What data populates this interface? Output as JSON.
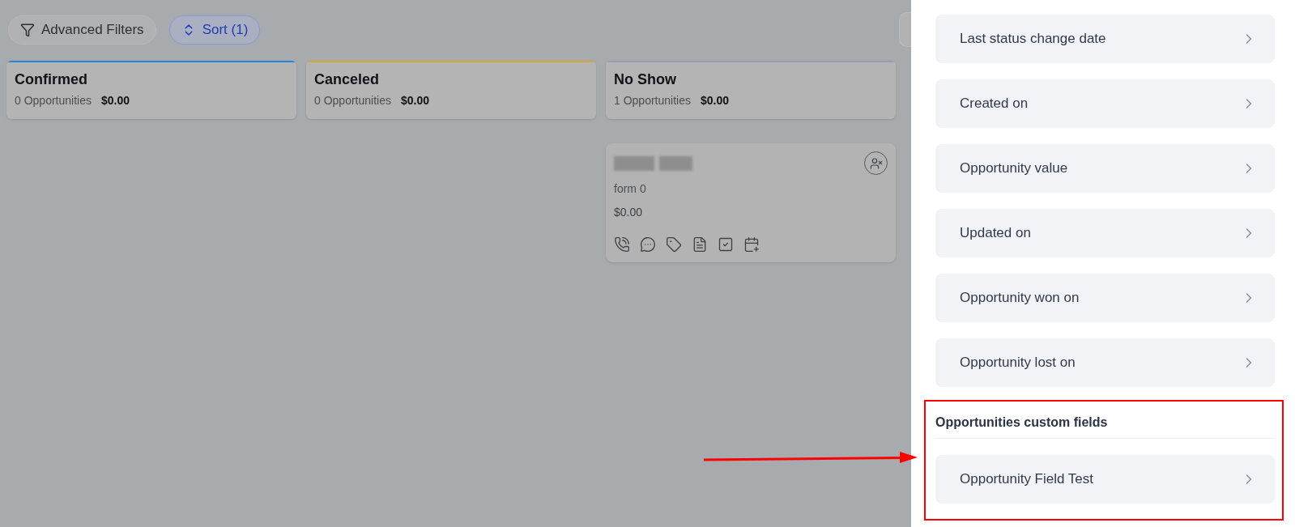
{
  "toolbar": {
    "buttons": [
      {
        "kind": "filter",
        "label": "Advanced Filters",
        "selected": false
      },
      {
        "kind": "sort",
        "label": "Sort (1)",
        "selected": true
      }
    ]
  },
  "columns": [
    {
      "title": "Confirmed",
      "count": "0 Opportunities",
      "total": "$0.00",
      "color": "#2385d4"
    },
    {
      "title": "Canceled",
      "count": "0 Opportunities",
      "total": "$0.00",
      "color": "#d2a73e"
    },
    {
      "title": "No Show",
      "count": "1 Opportunities",
      "total": "$0.00",
      "color": "#9c9cb9",
      "cards": [
        {
          "subtitle": "form 0",
          "value": "$0.00"
        }
      ]
    }
  ],
  "panel": {
    "items": [
      "Last status change date",
      "Created on",
      "Opportunity value",
      "Updated on",
      "Opportunity won on",
      "Opportunity lost on"
    ],
    "sections": [
      {
        "title": "Opportunities custom fields",
        "highlighted": true,
        "items": [
          "Opportunity Field Test"
        ]
      }
    ]
  }
}
